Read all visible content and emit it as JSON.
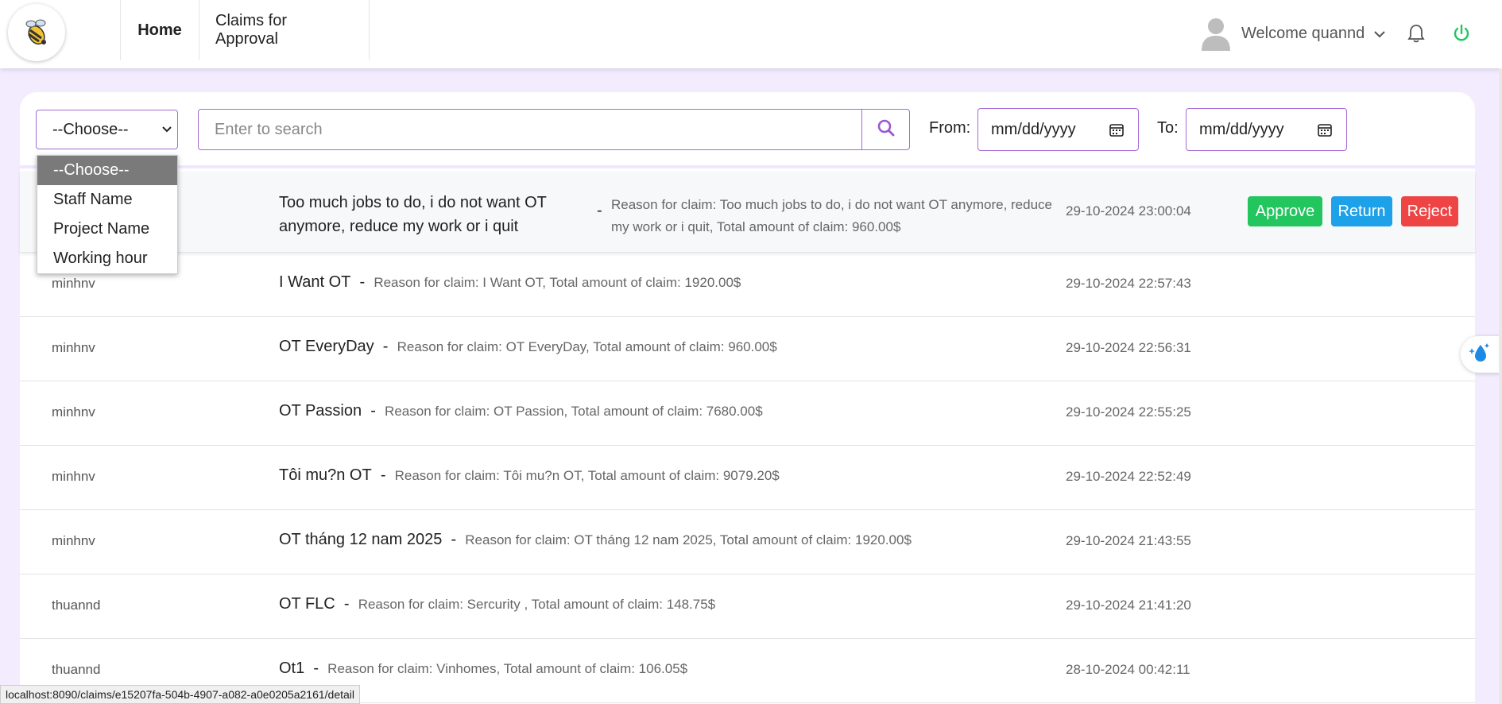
{
  "nav": {
    "home": "Home",
    "claims": "Claims for Approval",
    "welcome": "Welcome quannd"
  },
  "filter": {
    "select_value": "--Choose--",
    "options": [
      "--Choose--",
      "Staff Name",
      "Project Name",
      "Working hour"
    ],
    "search_placeholder": "Enter to search",
    "from_label": "From:",
    "from_value": "mm/dd/yyyy",
    "to_label": "To:",
    "to_value": "mm/dd/yyyy"
  },
  "actions": {
    "approve": "Approve",
    "return": "Return",
    "reject": "Reject"
  },
  "rows": [
    {
      "staff": "",
      "title_1": "Too much jobs to do, i do not want OT",
      "title_2": "anymore, reduce my work or i quit",
      "reason_1": "Reason for claim: Too much jobs to do, i do not want OT anymore, reduce",
      "reason_2": "my work or i quit, Total amount of claim: 960.00$",
      "time": "29-10-2024 23:00:04"
    },
    {
      "staff": "minhnv",
      "title": "I Want OT",
      "reason": "Reason for claim: I Want OT, Total amount of claim: 1920.00$",
      "time": "29-10-2024 22:57:43"
    },
    {
      "staff": "minhnv",
      "title": "OT EveryDay",
      "reason": "Reason for claim: OT EveryDay, Total amount of claim: 960.00$",
      "time": "29-10-2024 22:56:31"
    },
    {
      "staff": "minhnv",
      "title": "OT Passion",
      "reason": "Reason for claim: OT Passion, Total amount of claim: 7680.00$",
      "time": "29-10-2024 22:55:25"
    },
    {
      "staff": "minhnv",
      "title": "Tôi mu?n OT",
      "reason": "Reason for claim: Tôi mu?n OT, Total amount of claim: 9079.20$",
      "time": "29-10-2024 22:52:49"
    },
    {
      "staff": "minhnv",
      "title": "OT tháng 12 nam 2025",
      "reason": "Reason for claim: OT tháng 12 nam 2025, Total amount of claim: 1920.00$",
      "time": "29-10-2024 21:43:55"
    },
    {
      "staff": "thuannd",
      "title": "OT FLC",
      "reason": "Reason for claim: Sercurity , Total amount of claim: 148.75$",
      "time": "29-10-2024 21:41:20"
    },
    {
      "staff": "thuannd",
      "title": "Ot1",
      "reason": "Reason for claim: Vinhomes, Total amount of claim: 106.05$",
      "time": "28-10-2024 00:42:11"
    }
  ],
  "separator": "-",
  "status_url": "localhost:8090/claims/e15207fa-504b-4907-a082-a0e0205a2161/detail",
  "colors": {
    "accent": "#a46ad6",
    "approve": "#22c55e",
    "return": "#1da1e8",
    "reject": "#ef4444",
    "power": "#22c55e"
  },
  "icons": [
    "logo-icon",
    "user-avatar-icon",
    "chevron-down-icon",
    "bell-icon",
    "power-icon",
    "search-icon",
    "calendar-icon",
    "sparkle-drop-icon"
  ]
}
